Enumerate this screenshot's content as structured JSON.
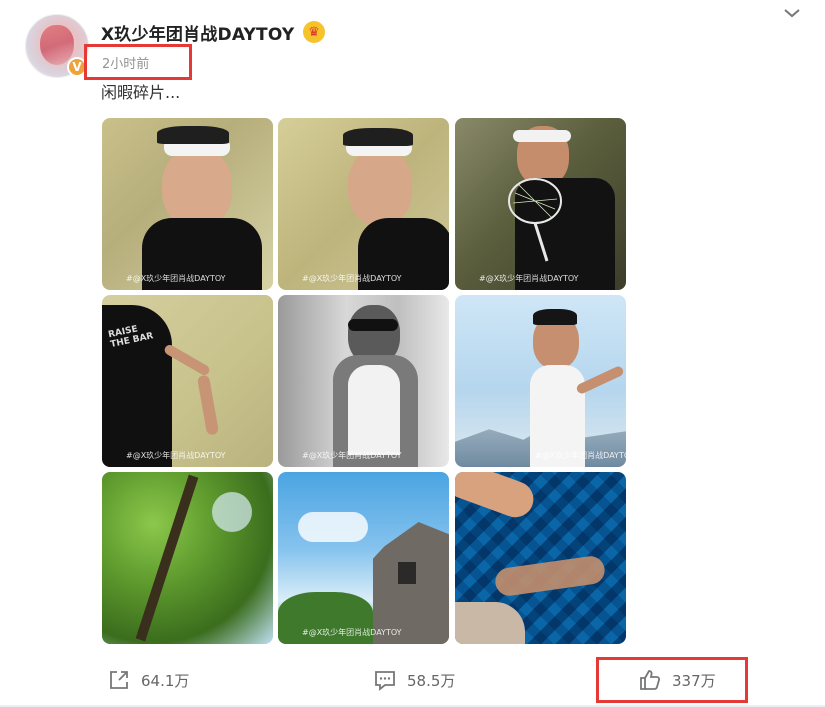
{
  "post": {
    "username": "X玖少年团肖战DAYTOY",
    "time": "2小时前",
    "content": "闲暇碎片...",
    "verified_badge": "V"
  },
  "images": [
    {
      "watermark": "#@X玖少年团肖战DAYTOY",
      "scene": "portrait-gym-smile"
    },
    {
      "watermark": "#@X玖少年团肖战DAYTOY",
      "scene": "portrait-gym-profile"
    },
    {
      "watermark": "#@X玖少年团肖战DAYTOY",
      "scene": "badminton-racket"
    },
    {
      "watermark": "#@X玖少年团肖战DAYTOY",
      "scene": "badminton-swing"
    },
    {
      "watermark": "#@X玖少年团肖战DAYTOY",
      "scene": "black-white-tank"
    },
    {
      "watermark": "#@X玖少年团肖战DAYTOY",
      "scene": "mountain-sky"
    },
    {
      "watermark": "",
      "scene": "tree-canopy"
    },
    {
      "watermark": "#@X玖少年团肖战DAYTOY",
      "scene": "old-building-sky"
    },
    {
      "watermark": "",
      "scene": "pool-tiles"
    }
  ],
  "actions": {
    "share_count": "64.1万",
    "comment_count": "58.5万",
    "like_count": "337万"
  },
  "icons": {
    "share": "share-icon",
    "comment": "comment-icon",
    "like": "thumbs-up-icon",
    "more": "chevron-down-icon",
    "crown": "crown-icon"
  },
  "colors": {
    "highlight": "#e53935",
    "muted_text": "#939393"
  }
}
